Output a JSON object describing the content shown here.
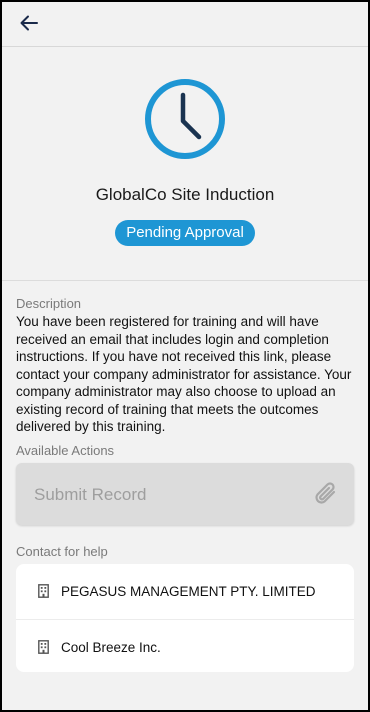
{
  "header": {
    "back_icon": "arrow-left-icon"
  },
  "training": {
    "status_icon": "clock-icon",
    "title": "GlobalCo Site Induction",
    "status": "Pending Approval",
    "accent_color": "#1e96d4"
  },
  "description": {
    "label": "Description",
    "text": "You have been registered for training and will have received an email that includes login and completion instructions. If you have not received this link, please contact your company administrator for assistance. Your company administrator may also choose to upload an existing record of training that meets the outcomes delivered by this training."
  },
  "actions": {
    "label": "Available Actions",
    "submit_label": "Submit Record",
    "submit_icon": "paperclip-icon"
  },
  "contacts": {
    "label": "Contact for help",
    "items": [
      {
        "icon": "building-icon",
        "name": "PEGASUS MANAGEMENT PTY. LIMITED"
      },
      {
        "icon": "building-icon",
        "name": "Cool Breeze Inc."
      }
    ]
  }
}
